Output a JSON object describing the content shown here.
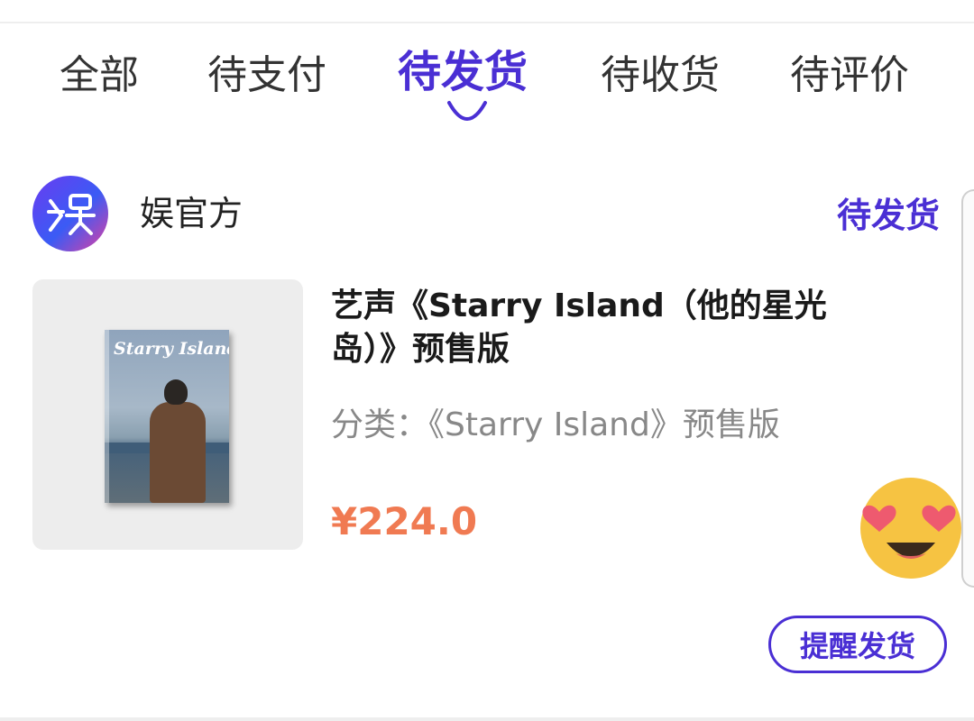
{
  "tabs": [
    {
      "label": "全部"
    },
    {
      "label": "待支付"
    },
    {
      "label": "待发货"
    },
    {
      "label": "待收货"
    },
    {
      "label": "待评价"
    }
  ],
  "active_tab": "待发货",
  "shop": {
    "avatar_icon": "yu-logo-icon",
    "name": "娱官方",
    "status": "待发货"
  },
  "product": {
    "image_text": "Starry Island",
    "title": "艺声《Starry Island（他的星光岛）》预售版",
    "category": "分类：《Starry Island》预售版",
    "price": "¥224.0"
  },
  "actions": {
    "remind_label": "提醒发货"
  },
  "colors": {
    "accent": "#4a2fd4",
    "price": "#f07a52",
    "muted": "#888888"
  }
}
